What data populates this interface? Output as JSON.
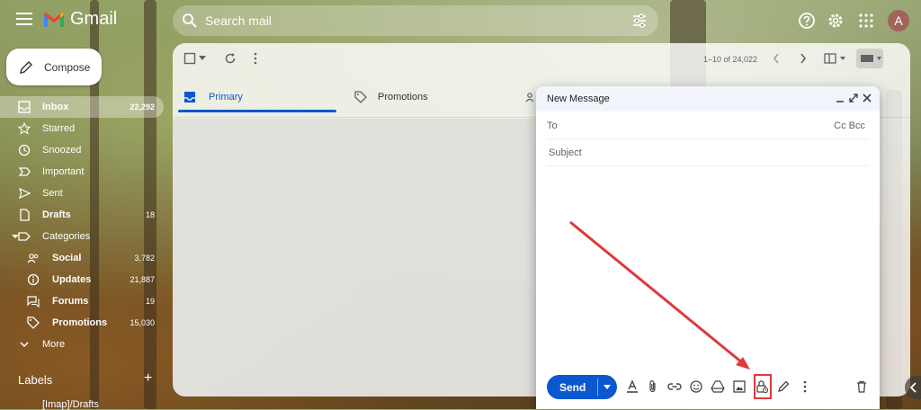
{
  "header": {
    "app_name": "Gmail",
    "search_placeholder": "Search mail",
    "avatar_initial": "A",
    "icons": [
      "menu-icon",
      "search-icon",
      "filter-icon",
      "help-icon",
      "gear-icon",
      "apps-icon"
    ]
  },
  "compose_button": {
    "label": "Compose"
  },
  "sidebar": {
    "items": [
      {
        "label": "Inbox",
        "count": "22,292",
        "icon": "inbox-icon",
        "active": true,
        "bold": true
      },
      {
        "label": "Starred",
        "count": "",
        "icon": "star-icon"
      },
      {
        "label": "Snoozed",
        "count": "",
        "icon": "clock-icon"
      },
      {
        "label": "Important",
        "count": "",
        "icon": "important-icon"
      },
      {
        "label": "Sent",
        "count": "",
        "icon": "send-icon"
      },
      {
        "label": "Drafts",
        "count": "18",
        "icon": "draft-icon",
        "bold": true
      },
      {
        "label": "Categories",
        "count": "",
        "icon": "label-icon"
      }
    ],
    "categories": [
      {
        "label": "Social",
        "count": "3,782",
        "icon": "people-icon"
      },
      {
        "label": "Updates",
        "count": "21,887",
        "icon": "info-icon"
      },
      {
        "label": "Forums",
        "count": "19",
        "icon": "forum-icon"
      },
      {
        "label": "Promotions",
        "count": "15,030",
        "icon": "tag-icon"
      }
    ],
    "more_label": "More",
    "labels_heading": "Labels",
    "labels": [
      {
        "label": "[Imap]/Drafts"
      }
    ]
  },
  "mail_toolbar": {
    "page_range": "1–10 of 24,022"
  },
  "tabs": [
    {
      "label": "Primary",
      "active": true
    },
    {
      "label": "Promotions",
      "active": false
    }
  ],
  "compose_window": {
    "title": "New Message",
    "to_label": "To",
    "cc_bcc_label": "Cc Bcc",
    "subject_placeholder": "Subject",
    "send_label": "Send"
  },
  "colors": {
    "accent": "#0b57d0",
    "highlight": "#e0383c"
  }
}
